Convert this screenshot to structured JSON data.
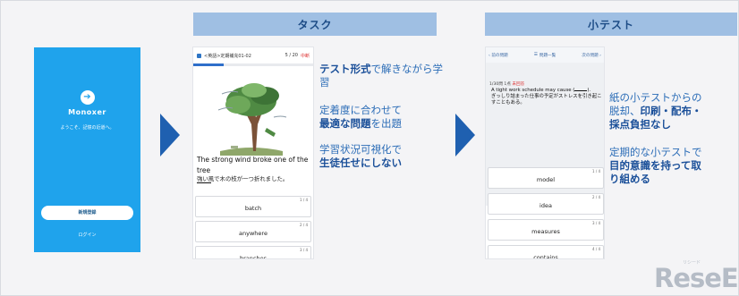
{
  "headers": {
    "task": "タスク",
    "quiz": "小テスト"
  },
  "login": {
    "brand": "Monoxer",
    "greeting": "ようこそ、記憶の近道へ。",
    "register_button": "新規登録",
    "login_link": "ログイン"
  },
  "task_screen": {
    "breadcrumb": "<英語>定期補充01-02",
    "counter": "5 / 20",
    "stop": "中断",
    "progress": 0.25,
    "sentence_part1": "The strong wind broke one of the tree",
    "translation": "強い風で木の枝が一つ折れました。",
    "choices": [
      {
        "num": "1 / 4",
        "label": "batch"
      },
      {
        "num": "2 / 4",
        "label": "anywhere"
      },
      {
        "num": "3 / 4",
        "label": "branches"
      }
    ]
  },
  "task_copy": {
    "p1_bold": "テスト形式",
    "p1_rest": "で解きながら学習",
    "p2_a": "定着度に合わせて",
    "p2_bold": "最適な問題",
    "p2_rest": "を出題",
    "p3_a": "学習状況可視化で",
    "p3_bold": "生徒任せにしない"
  },
  "quiz_screen": {
    "prev": "前の問題",
    "list": "問題一覧",
    "next": "次の問題",
    "number": "1/30問",
    "score": "1点",
    "status": "未回答",
    "question": "A tight work schedule may cause (",
    "question_end": ").",
    "question_ja": "ぎっしり詰まった仕事の予定がストレスを引き起こすこともある。",
    "choices": [
      {
        "num": "1 / 4",
        "label": "model"
      },
      {
        "num": "2 / 4",
        "label": "idea"
      },
      {
        "num": "3 / 4",
        "label": "measures"
      },
      {
        "num": "4 / 4",
        "label": "contains"
      }
    ]
  },
  "quiz_copy": {
    "p1_a": "紙の小テストからの脱却、",
    "p1_bold": "印刷・配布・採点負担なし",
    "p2_a": "定期的な小テストで",
    "p2_bold": "目的意識を持って取り組める"
  },
  "watermark": {
    "brand": "ReseEd",
    "sub": "リシード"
  },
  "colors": {
    "accent": "#1fa3ec",
    "header_band": "#9fbfe3",
    "arrow": "#1f60b0",
    "text_blue": "#2c6db7",
    "text_dark_blue": "#1a4f99"
  }
}
